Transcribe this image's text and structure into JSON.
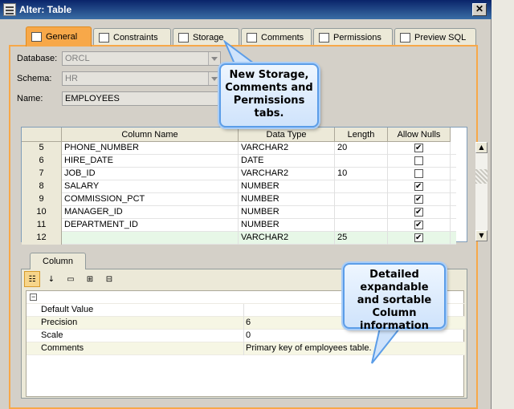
{
  "window": {
    "title": "Alter: Table",
    "close_glyph": "✕"
  },
  "tabs": [
    {
      "label": "General",
      "icon": "table-grid-icon",
      "active": true
    },
    {
      "label": "Constraints",
      "icon": "constraints-icon",
      "active": false
    },
    {
      "label": "Storage",
      "icon": "storage-icon",
      "active": false
    },
    {
      "label": "Comments",
      "icon": "comments-icon",
      "active": false
    },
    {
      "label": "Permissions",
      "icon": "permissions-icon",
      "active": false
    },
    {
      "label": "Preview SQL",
      "icon": "preview-sql-icon",
      "active": false
    }
  ],
  "form": {
    "database_label": "Database:",
    "database_value": "ORCL",
    "schema_label": "Schema:",
    "schema_value": "HR",
    "name_label": "Name:",
    "name_value": "EMPLOYEES"
  },
  "grid": {
    "headers": [
      "Column Name",
      "Data Type",
      "Length",
      "Allow Nulls"
    ],
    "rows": [
      {
        "num": "5",
        "name": "PHONE_NUMBER",
        "type": "VARCHAR2",
        "length": "20",
        "nulls": true
      },
      {
        "num": "6",
        "name": "HIRE_DATE",
        "type": "DATE",
        "length": "",
        "nulls": false
      },
      {
        "num": "7",
        "name": "JOB_ID",
        "type": "VARCHAR2",
        "length": "10",
        "nulls": false
      },
      {
        "num": "8",
        "name": "SALARY",
        "type": "NUMBER",
        "length": "",
        "nulls": true
      },
      {
        "num": "9",
        "name": "COMMISSION_PCT",
        "type": "NUMBER",
        "length": "",
        "nulls": true
      },
      {
        "num": "10",
        "name": "MANAGER_ID",
        "type": "NUMBER",
        "length": "",
        "nulls": true
      },
      {
        "num": "11",
        "name": "DEPARTMENT_ID",
        "type": "NUMBER",
        "length": "",
        "nulls": true
      },
      {
        "num": "12",
        "name": "",
        "type": "VARCHAR2",
        "length": "25",
        "nulls": true
      }
    ]
  },
  "column_panel": {
    "tab_label": "Column",
    "toolbar": [
      "categorized-icon",
      "sort-az-icon",
      "properties-icon",
      "expand-icon",
      "collapse-icon"
    ],
    "collapse_glyph": "−",
    "properties": [
      {
        "name": "Default Value",
        "value": ""
      },
      {
        "name": "Precision",
        "value": "6"
      },
      {
        "name": "Scale",
        "value": "0"
      },
      {
        "name": "Comments",
        "value": "Primary key of employees table."
      }
    ]
  },
  "callouts": {
    "tabs_note": "New Storage, Comments and Permissions tabs.",
    "column_note": "Detailed expandable and sortable Column information"
  },
  "colors": {
    "active_tab": "#f7a849",
    "title_bar": "#0a246a",
    "callout_border": "#5b9de8"
  }
}
